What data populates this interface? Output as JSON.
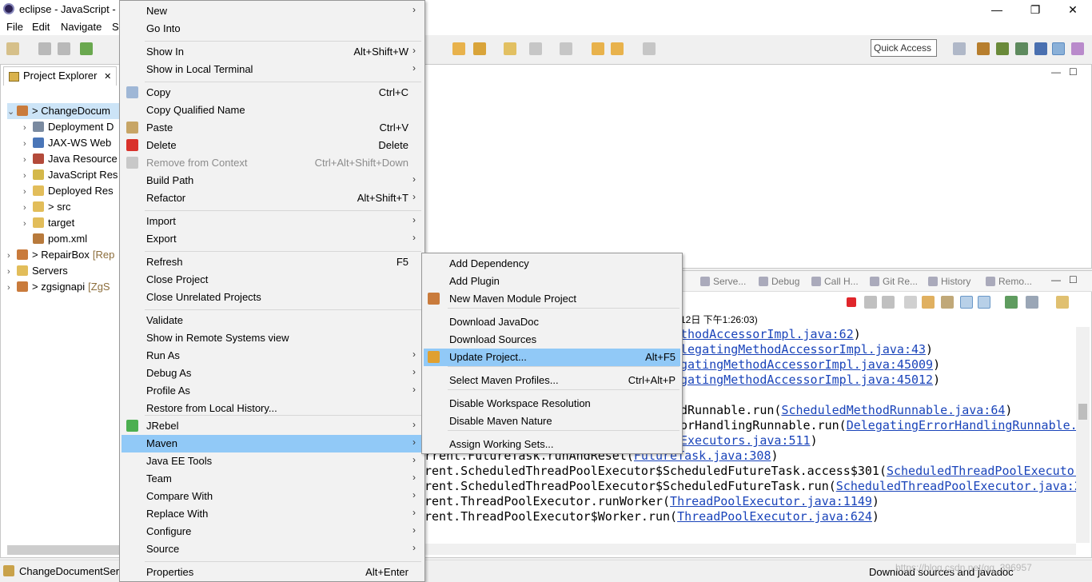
{
  "window": {
    "title": "eclipse - JavaScript -",
    "minimize": "—",
    "restore": "❐",
    "close": "✕"
  },
  "menubar": [
    "File",
    "Edit",
    "Navigate",
    "S"
  ],
  "quick_access": "Quick Access",
  "project_explorer": {
    "tab_label": "Project Explorer",
    "tab_close": "✕",
    "tree": [
      {
        "arrow": "⌄",
        "name": "> ChangeDocum",
        "extra": "",
        "icon": "maven-project-icon"
      },
      {
        "arrow": "›",
        "name": "Deployment D",
        "extra": "",
        "icon": "deployment-icon"
      },
      {
        "arrow": "›",
        "name": "JAX-WS Web",
        "extra": "",
        "icon": "webservice-icon"
      },
      {
        "arrow": "›",
        "name": "Java Resource",
        "extra": "",
        "icon": "java-resources-icon"
      },
      {
        "arrow": "›",
        "name": "JavaScript Res",
        "extra": "",
        "icon": "javascript-icon"
      },
      {
        "arrow": "›",
        "name": "Deployed Res",
        "extra": "",
        "icon": "folder-icon"
      },
      {
        "arrow": "›",
        "name": "> src",
        "extra": "",
        "icon": "folder-icon"
      },
      {
        "arrow": "›",
        "name": "target",
        "extra": "",
        "icon": "folder-icon"
      },
      {
        "arrow": "",
        "name": "pom.xml",
        "extra": "",
        "icon": "xml-file-icon"
      },
      {
        "arrow": "›",
        "name": "> RepairBox",
        "extra": "[Rep",
        "icon": "maven-project-icon"
      },
      {
        "arrow": "›",
        "name": "Servers",
        "extra": "",
        "icon": "folder-icon"
      },
      {
        "arrow": "›",
        "name": "> zgsignapi",
        "extra": "[ZgS",
        "icon": "maven-project-icon"
      }
    ]
  },
  "context_menu": {
    "items": [
      {
        "label": "New",
        "shortcut": "",
        "submenu": true,
        "icon": ""
      },
      {
        "label": "Go Into",
        "shortcut": "",
        "submenu": false,
        "icon": ""
      },
      {
        "label": "Show In",
        "shortcut": "Alt+Shift+W",
        "submenu": true,
        "icon": ""
      },
      {
        "label": "Show in Local Terminal",
        "shortcut": "",
        "submenu": true,
        "icon": ""
      },
      {
        "label": "Copy",
        "shortcut": "Ctrl+C",
        "submenu": false,
        "icon": "copy-icon"
      },
      {
        "label": "Copy Qualified Name",
        "shortcut": "",
        "submenu": false,
        "icon": ""
      },
      {
        "label": "Paste",
        "shortcut": "Ctrl+V",
        "submenu": false,
        "icon": "paste-icon"
      },
      {
        "label": "Delete",
        "shortcut": "Delete",
        "submenu": false,
        "icon": "delete-icon"
      },
      {
        "label": "Remove from Context",
        "shortcut": "Ctrl+Alt+Shift+Down",
        "submenu": false,
        "icon": "remove-context-icon",
        "disabled": true
      },
      {
        "label": "Build Path",
        "shortcut": "",
        "submenu": true,
        "icon": ""
      },
      {
        "label": "Refactor",
        "shortcut": "Alt+Shift+T",
        "submenu": true,
        "icon": ""
      },
      {
        "label": "Import",
        "shortcut": "",
        "submenu": true,
        "icon": ""
      },
      {
        "label": "Export",
        "shortcut": "",
        "submenu": true,
        "icon": ""
      },
      {
        "label": "Refresh",
        "shortcut": "F5",
        "submenu": false,
        "icon": ""
      },
      {
        "label": "Close Project",
        "shortcut": "",
        "submenu": false,
        "icon": ""
      },
      {
        "label": "Close Unrelated Projects",
        "shortcut": "",
        "submenu": false,
        "icon": ""
      },
      {
        "label": "Validate",
        "shortcut": "",
        "submenu": false,
        "icon": ""
      },
      {
        "label": "Show in Remote Systems view",
        "shortcut": "",
        "submenu": false,
        "icon": ""
      },
      {
        "label": "Run As",
        "shortcut": "",
        "submenu": true,
        "icon": ""
      },
      {
        "label": "Debug As",
        "shortcut": "",
        "submenu": true,
        "icon": ""
      },
      {
        "label": "Profile As",
        "shortcut": "",
        "submenu": true,
        "icon": ""
      },
      {
        "label": "Restore from Local History...",
        "shortcut": "",
        "submenu": false,
        "icon": ""
      },
      {
        "label": "JRebel",
        "shortcut": "",
        "submenu": true,
        "icon": "jrebel-icon"
      },
      {
        "label": "Maven",
        "shortcut": "",
        "submenu": true,
        "icon": "",
        "highlighted": true
      },
      {
        "label": "Java EE Tools",
        "shortcut": "",
        "submenu": true,
        "icon": ""
      },
      {
        "label": "Team",
        "shortcut": "",
        "submenu": true,
        "icon": ""
      },
      {
        "label": "Compare With",
        "shortcut": "",
        "submenu": true,
        "icon": ""
      },
      {
        "label": "Replace With",
        "shortcut": "",
        "submenu": true,
        "icon": ""
      },
      {
        "label": "Configure",
        "shortcut": "",
        "submenu": true,
        "icon": ""
      },
      {
        "label": "Source",
        "shortcut": "",
        "submenu": true,
        "icon": ""
      },
      {
        "label": "Properties",
        "shortcut": "Alt+Enter",
        "submenu": false,
        "icon": ""
      }
    ]
  },
  "maven_submenu": {
    "items": [
      {
        "label": "Add Dependency",
        "shortcut": "",
        "icon": ""
      },
      {
        "label": "Add Plugin",
        "shortcut": "",
        "icon": ""
      },
      {
        "label": "New Maven Module Project",
        "shortcut": "",
        "icon": "maven-module-icon"
      },
      {
        "label": "Download JavaDoc",
        "shortcut": "",
        "icon": ""
      },
      {
        "label": "Download Sources",
        "shortcut": "",
        "icon": ""
      },
      {
        "label": "Update Project...",
        "shortcut": "Alt+F5",
        "icon": "update-project-icon",
        "highlighted": true
      },
      {
        "label": "Select Maven Profiles...",
        "shortcut": "Ctrl+Alt+P",
        "icon": ""
      },
      {
        "label": "Disable Workspace Resolution",
        "shortcut": "",
        "icon": ""
      },
      {
        "label": "Disable Maven Nature",
        "shortcut": "",
        "icon": ""
      },
      {
        "label": "Assign Working Sets...",
        "shortcut": "",
        "icon": ""
      }
    ]
  },
  "console": {
    "tabs": [
      {
        "label": "Serve...",
        "icon": "servers-icon"
      },
      {
        "label": "Debug",
        "icon": "debug-icon"
      },
      {
        "label": "Call H...",
        "icon": "call-hierarchy-icon"
      },
      {
        "label": "Git Re...",
        "icon": "git-repositories-icon"
      },
      {
        "label": "History",
        "icon": "history-icon"
      },
      {
        "label": "Remo...",
        "icon": "remote-systems-icon"
      }
    ],
    "header": "12日 下午1:26:03)",
    "lines": [
      {
        "pre": "",
        "link": "thodAccessorImpl.java:62",
        "post": ")"
      },
      {
        "pre": "",
        "link": "legatingMethodAccessorImpl.java:43",
        "post": ")"
      },
      {
        "pre": "",
        "link": "gatingMethodAccessorImpl.java:45009",
        "post": ")"
      },
      {
        "pre": "",
        "link": "gatingMethodAccessorImpl.java:45012",
        "post": ")"
      },
      {
        "pre": "",
        "link": "",
        "post": ""
      },
      {
        "pre": "dRunnable.run(",
        "link": "ScheduledMethodRunnable.java:64",
        "post": ")"
      },
      {
        "pre": "orHandlingRunnable.run(",
        "link": "DelegatingErrorHandlingRunnable.",
        "post": ""
      },
      {
        "pre": "",
        "link": "Executors.java:511",
        "post": ")"
      },
      {
        "pre": "rrent.FutureTask.runAndReset(",
        "link": "FutureTask.java:308",
        "post": ")"
      },
      {
        "pre": "rent.ScheduledThreadPoolExecutor$ScheduledFutureTask.access$301(",
        "link": "ScheduledThreadPoolExecutor",
        "post": ""
      },
      {
        "pre": "rent.ScheduledThreadPoolExecutor$ScheduledFutureTask.run(",
        "link": "ScheduledThreadPoolExecutor.java:2",
        "post": ""
      },
      {
        "pre": "rent.ThreadPoolExecutor.runWorker(",
        "link": "ThreadPoolExecutor.java:1149",
        "post": ")"
      },
      {
        "pre": "rent.ThreadPoolExecutor$Worker.run(",
        "link": "ThreadPoolExecutor.java:624",
        "post": ")"
      }
    ]
  },
  "statusbar": {
    "left": "ChangeDocumentSer",
    "right": "Download sources and javadoc",
    "watermark": "https://blog.csdn.net/qq_396957"
  },
  "colors": {
    "highlight": "#91c9f7",
    "link": "#1a44ba"
  }
}
